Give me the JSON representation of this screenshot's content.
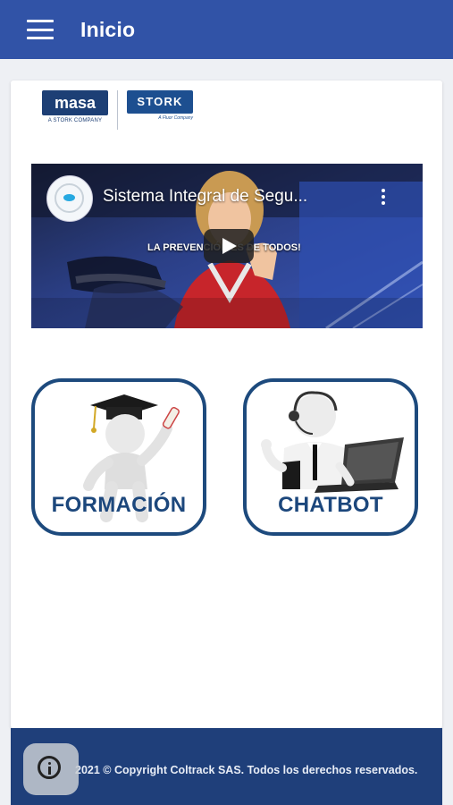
{
  "appbar": {
    "title": "Inicio",
    "menu_icon": "hamburger-menu-icon"
  },
  "logos": {
    "masa": "masa",
    "masa_sub": "A STORK COMPANY",
    "stork": "STORK",
    "stork_sub": "A Fluor Company"
  },
  "video": {
    "title": "Sistema Integral de Segu...",
    "caption": "LA PREVENCIÓN ES DE TODOS!",
    "more_icon": "more-vertical-icon",
    "play_icon": "play-icon"
  },
  "tiles": {
    "formacion": {
      "label": "FORMACIÓN",
      "icon": "graduate-figure-icon"
    },
    "chatbot": {
      "label": "CHATBOT",
      "icon": "support-agent-icon"
    }
  },
  "footer": {
    "text": "2021 © Copyright Coltrack SAS. Todos los derechos reservados."
  },
  "fab": {
    "icon": "info-icon"
  },
  "colors": {
    "appbar": "#3153a7",
    "footer": "#1f3f7a",
    "tile_border": "#1d4a7d",
    "background": "#eef0f4"
  }
}
